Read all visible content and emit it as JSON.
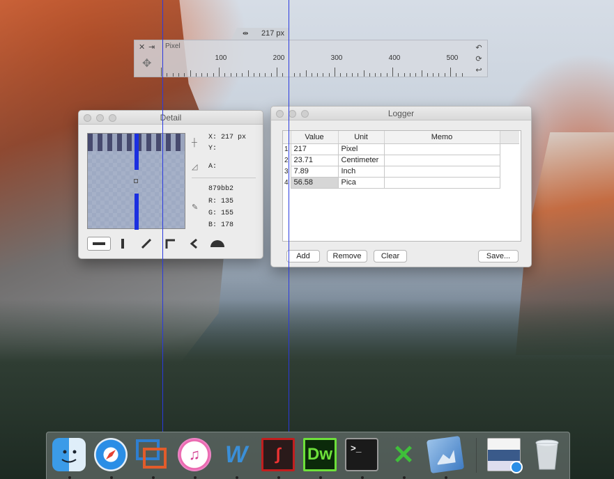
{
  "ruler": {
    "readout": "217 px",
    "unit": "Pixel",
    "tick_labels": [
      "100",
      "200",
      "300",
      "400",
      "500"
    ]
  },
  "detail": {
    "title": "Detail",
    "x_label": "X:",
    "x_value": "217 px",
    "y_label": "Y:",
    "a_label": "A:",
    "hex": "879bb2",
    "r_label": "R:",
    "r_value": "135",
    "g_label": "G:",
    "g_value": "155",
    "b_label": "B:",
    "b_value": "178"
  },
  "logger": {
    "title": "Logger",
    "columns": [
      "Value",
      "Unit",
      "Memo"
    ],
    "rows": [
      {
        "index": "1",
        "value": "217",
        "unit": "Pixel",
        "memo": ""
      },
      {
        "index": "2",
        "value": "23.71",
        "unit": "Centimeter",
        "memo": ""
      },
      {
        "index": "3",
        "value": "7.89",
        "unit": "Inch",
        "memo": ""
      },
      {
        "index": "4",
        "value": "56.58",
        "unit": "Pica",
        "memo": ""
      }
    ],
    "buttons": {
      "add": "Add",
      "remove": "Remove",
      "clear": "Clear",
      "save": "Save..."
    }
  },
  "dock": {
    "items": [
      "finder-icon",
      "safari-icon",
      "vmware-icon",
      "itunes-icon",
      "word-icon",
      "acrobat-icon",
      "dreamweaver-icon",
      "terminal-icon",
      "excel-icon",
      "preview-icon",
      "screenshot-icon",
      "trash-icon"
    ],
    "labels": {
      "dreamweaver": "Dw",
      "terminal": ">_"
    }
  },
  "colors": {
    "guide_line": "#2a3adf",
    "pixel_color": "#879bb2",
    "zoom_bar": "#1b2fe0"
  }
}
